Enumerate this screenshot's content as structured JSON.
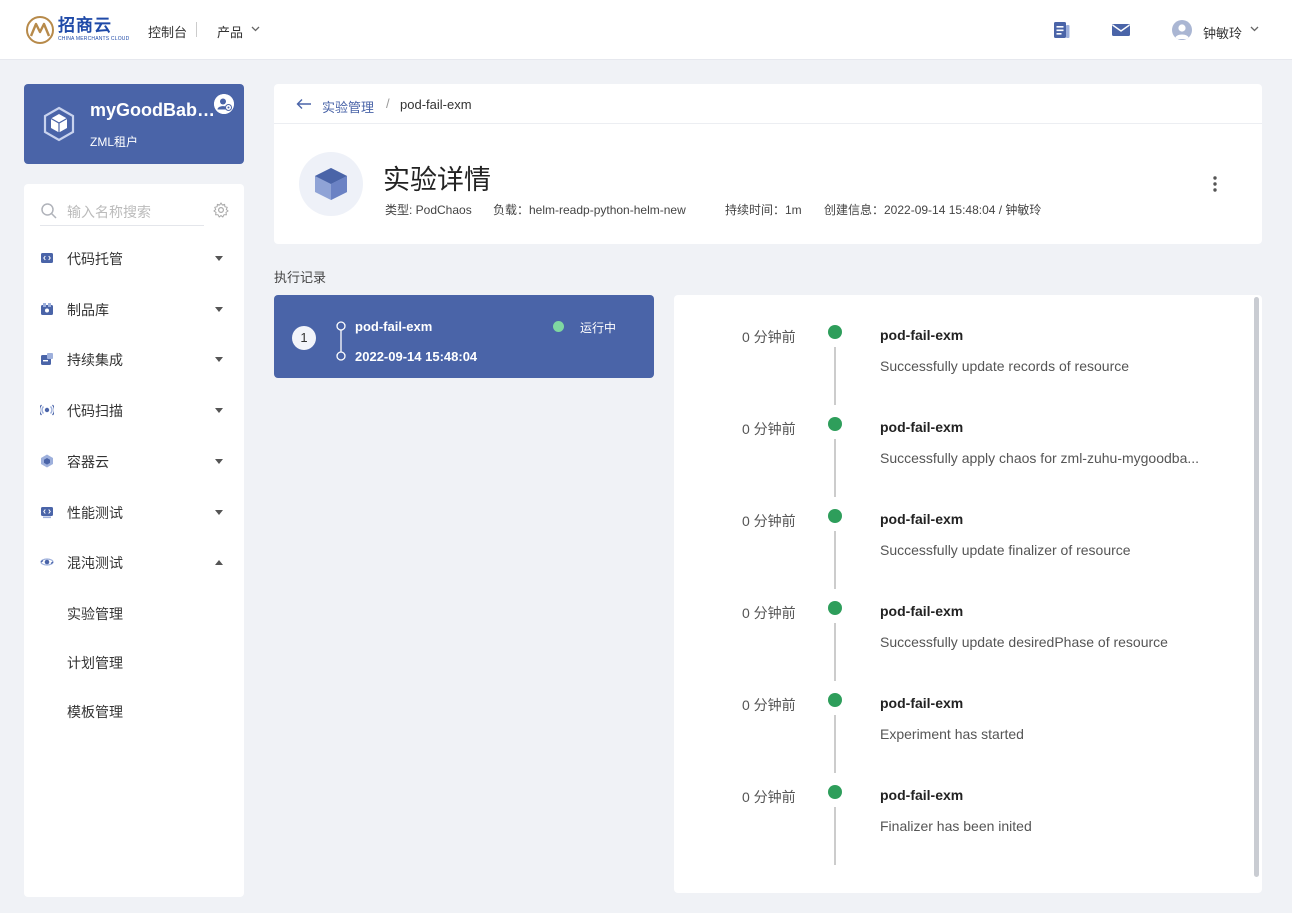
{
  "topbar": {
    "logo_cn": "招商云",
    "logo_en": "CHINA MERCHANTS CLOUD",
    "nav_console": "控制台",
    "nav_products": "产品",
    "user_name": "钟敏玲",
    "icons": [
      "doc-icon",
      "mail-icon",
      "avatar-icon",
      "chevron-down-icon"
    ]
  },
  "tenant": {
    "name": "myGoodBaby-z...",
    "subtitle": "ZML租户"
  },
  "sidebar": {
    "search_placeholder": "输入名称搜索",
    "menu": [
      {
        "label": "代码托管",
        "icon": "code-icon",
        "expanded": false
      },
      {
        "label": "制品库",
        "icon": "package-icon",
        "expanded": false
      },
      {
        "label": "持续集成",
        "icon": "ci-icon",
        "expanded": false
      },
      {
        "label": "代码扫描",
        "icon": "scan-icon",
        "expanded": false
      },
      {
        "label": "容器云",
        "icon": "container-icon",
        "expanded": false
      },
      {
        "label": "性能测试",
        "icon": "perf-icon",
        "expanded": false
      },
      {
        "label": "混沌测试",
        "icon": "chaos-icon",
        "expanded": true
      }
    ],
    "submenu": [
      "实验管理",
      "计划管理",
      "模板管理"
    ]
  },
  "breadcrumb": {
    "parent": "实验管理",
    "separator": "/",
    "current": "pod-fail-exm"
  },
  "experiment": {
    "title": "实验详情",
    "type": "类型: PodChaos",
    "load": "负载：helm-readp-python-helm-new",
    "duration": "持续时间：1m",
    "created": "创建信息：2022-09-14 15:48:04 / 钟敏玲"
  },
  "records": {
    "section_title": "执行记录",
    "run": {
      "index": "1",
      "name": "pod-fail-exm",
      "time": "2022-09-14 15:48:04",
      "status": "运行中",
      "status_color": "#7fd7a1"
    }
  },
  "timeline": [
    {
      "time": "0 分钟前",
      "title": "pod-fail-exm",
      "desc": "Successfully update records of resource"
    },
    {
      "time": "0 分钟前",
      "title": "pod-fail-exm",
      "desc": "Successfully apply chaos for zml-zuhu-mygoodba..."
    },
    {
      "time": "0 分钟前",
      "title": "pod-fail-exm",
      "desc": "Successfully update finalizer of resource"
    },
    {
      "time": "0 分钟前",
      "title": "pod-fail-exm",
      "desc": "Successfully update desiredPhase of resource"
    },
    {
      "time": "0 分钟前",
      "title": "pod-fail-exm",
      "desc": "Experiment has started"
    },
    {
      "time": "0 分钟前",
      "title": "pod-fail-exm",
      "desc": "Finalizer has been inited"
    }
  ],
  "colors": {
    "accent": "#4a64a8",
    "success": "#2e9e5b",
    "background": "#f0f2f6"
  }
}
